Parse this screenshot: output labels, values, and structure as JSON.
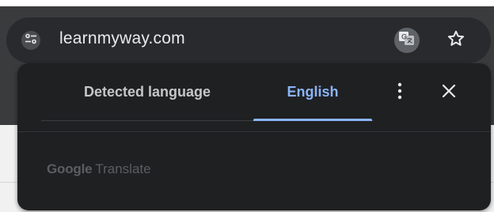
{
  "address_bar": {
    "url": "learnmyway.com",
    "site_info_icon": "tune-icon",
    "translate_icon": "translate-icon",
    "bookmark_icon": "star-outline-icon"
  },
  "translate_bubble": {
    "tabs": [
      {
        "label": "Detected language",
        "selected": false
      },
      {
        "label": "English",
        "selected": true
      }
    ],
    "more_icon": "more-vertical-icon",
    "close_icon": "close-icon",
    "footer_brand": "Google",
    "footer_product": "Translate"
  },
  "colors": {
    "accent": "#8ab4f8",
    "bubble_bg": "#1f2022",
    "omnibox_bg": "#282a2d"
  }
}
